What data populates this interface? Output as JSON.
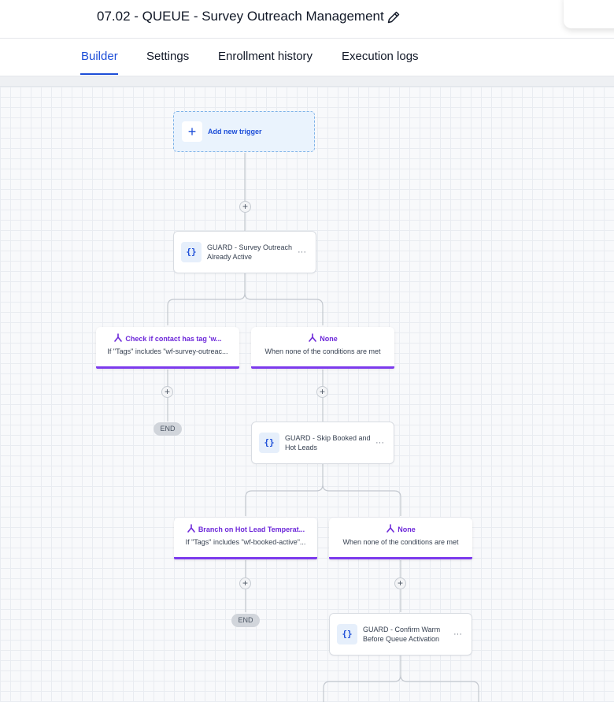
{
  "header": {
    "title": "07.02 - QUEUE - Survey Outreach Management"
  },
  "tabs": [
    {
      "label": "Builder",
      "active": true
    },
    {
      "label": "Settings",
      "active": false
    },
    {
      "label": "Enrollment history",
      "active": false
    },
    {
      "label": "Execution logs",
      "active": false
    }
  ],
  "colors": {
    "accent": "#1d4ed8",
    "branch_accent": "#7c3aed"
  },
  "workflow": {
    "trigger": {
      "label": "Add new trigger"
    },
    "actions": [
      {
        "label": "GUARD - Survey Outreach Already Active",
        "icon": "code-braces-icon"
      },
      {
        "label": "GUARD - Skip Booked and Hot Leads",
        "icon": "code-braces-icon"
      },
      {
        "label": "GUARD - Confirm Warm Before Queue Activation",
        "icon": "code-braces-icon"
      }
    ],
    "branches": [
      {
        "title": "Check if contact has tag 'w...",
        "subtitle": "If \"Tags\" includes \"wf-survey-outreac..."
      },
      {
        "title": "None",
        "subtitle": "When none of the conditions are met"
      },
      {
        "title": "Branch on Hot Lead Temperat...",
        "subtitle": "If \"Tags\" includes \"wf-booked-active\"..."
      },
      {
        "title": "None",
        "subtitle": "When none of the conditions are met"
      }
    ],
    "end_label": "END",
    "add_step_symbol": "+",
    "more_symbol": "···"
  }
}
